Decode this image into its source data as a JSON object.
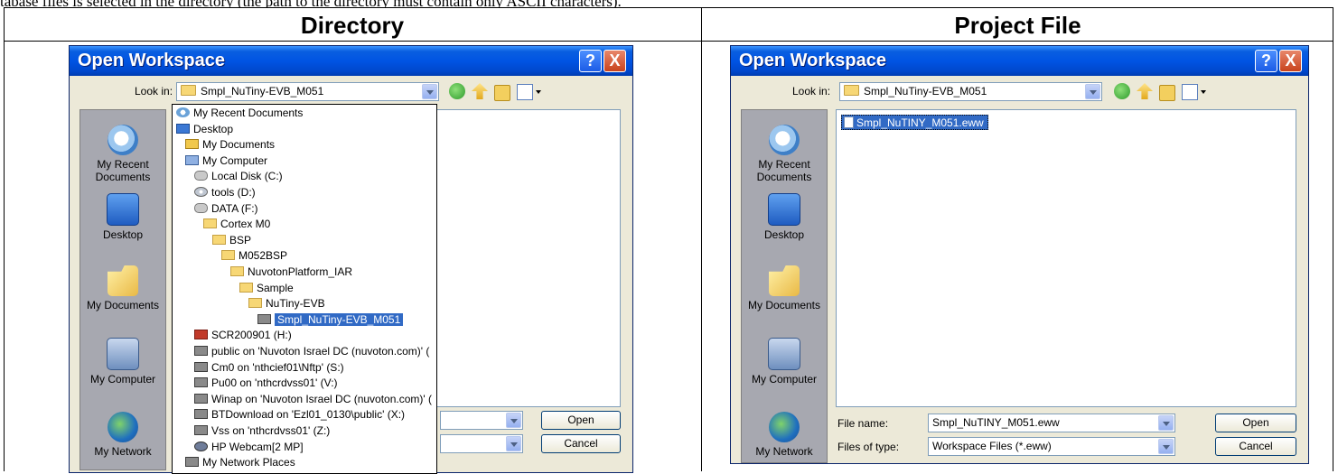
{
  "caption_cut": "tabase files is selected in the directory (the path to the directory must contain only ASCII characters).",
  "columns": [
    "Directory",
    "Project File"
  ],
  "left": {
    "title": "Open Workspace",
    "look_in_label": "Look in:",
    "look_in_value": "Smpl_NuTiny-EVB_M051",
    "places": [
      "My Recent\nDocuments",
      "Desktop",
      "My Documents",
      "My Computer",
      "My Network"
    ],
    "dropdown": [
      {
        "icon": "recent",
        "label": "My Recent Documents",
        "indent": 0
      },
      {
        "icon": "desk",
        "label": "Desktop",
        "indent": 0
      },
      {
        "icon": "docs",
        "label": "My Documents",
        "indent": 1
      },
      {
        "icon": "comp",
        "label": "My Computer",
        "indent": 1
      },
      {
        "icon": "disk",
        "label": "Local Disk (C:)",
        "indent": 2
      },
      {
        "icon": "cd",
        "label": "tools (D:)",
        "indent": 2
      },
      {
        "icon": "disk",
        "label": "DATA (F:)",
        "indent": 2
      },
      {
        "icon": "folder",
        "label": "Cortex M0",
        "indent": 3
      },
      {
        "icon": "folder",
        "label": "BSP",
        "indent": 4
      },
      {
        "icon": "folder",
        "label": "M052BSP",
        "indent": 5
      },
      {
        "icon": "folder",
        "label": "NuvotonPlatform_IAR",
        "indent": 6
      },
      {
        "icon": "folder",
        "label": "Sample",
        "indent": 7
      },
      {
        "icon": "folder",
        "label": "NuTiny-EVB",
        "indent": 8
      },
      {
        "icon": "folder-open",
        "label": "Smpl_NuTiny-EVB_M051",
        "indent": 9,
        "selected": true
      },
      {
        "icon": "cam",
        "label": "SCR200901 (H:)",
        "indent": 2
      },
      {
        "icon": "net",
        "label": "public on 'Nuvoton Israel DC (nuvoton.com)' (",
        "indent": 2
      },
      {
        "icon": "net",
        "label": "Cm0 on 'nthcief01\\Nftp' (S:)",
        "indent": 2
      },
      {
        "icon": "net",
        "label": "Pu00 on 'nthcrdvss01' (V:)",
        "indent": 2
      },
      {
        "icon": "net",
        "label": "Winap on 'Nuvoton Israel DC (nuvoton.com)' (",
        "indent": 2
      },
      {
        "icon": "net",
        "label": "BTDownload on 'Ezl01_0130\\public' (X:)",
        "indent": 2
      },
      {
        "icon": "net",
        "label": "Vss on 'nthcrdvss01' (Z:)",
        "indent": 2
      },
      {
        "icon": "webcam",
        "label": "HP Webcam[2 MP]",
        "indent": 2
      },
      {
        "icon": "net",
        "label": "My Network Places",
        "indent": 1
      }
    ],
    "open_label": "Open",
    "cancel_label": "Cancel"
  },
  "right": {
    "title": "Open Workspace",
    "look_in_label": "Look in:",
    "look_in_value": "Smpl_NuTiny-EVB_M051",
    "places": [
      "My Recent\nDocuments",
      "Desktop",
      "My Documents",
      "My Computer",
      "My Network"
    ],
    "file": "Smpl_NuTINY_M051.eww",
    "file_name_label": "File name:",
    "file_name_value": "Smpl_NuTINY_M051.eww",
    "files_of_type_label": "Files of type:",
    "files_of_type_value": "Workspace Files (*.eww)",
    "open_label": "Open",
    "cancel_label": "Cancel"
  },
  "title_buttons": {
    "help": "?",
    "close": "X"
  }
}
